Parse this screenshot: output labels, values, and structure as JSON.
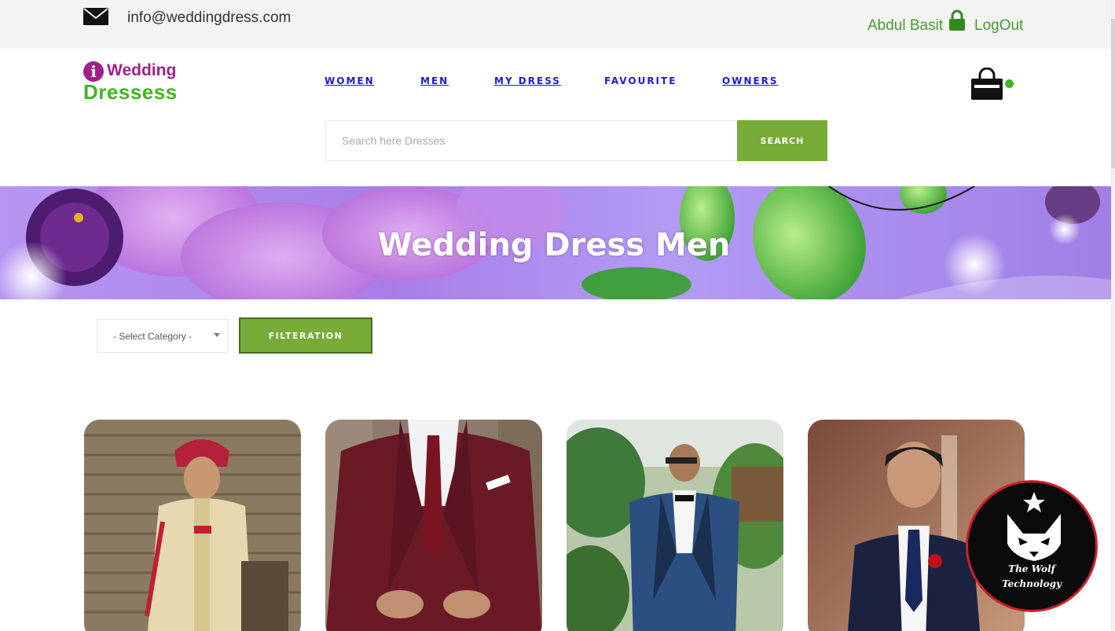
{
  "topbar": {
    "email": "info@weddingdress.com",
    "user_name": "Abdul Basit",
    "logout_label": "LogOut",
    "icons": [
      "mail-icon",
      "lock-icon"
    ]
  },
  "logo": {
    "letter": "i",
    "top_text": "Wedding",
    "bottom_text": "Dressess"
  },
  "nav": {
    "items": [
      {
        "label": "WOMEN"
      },
      {
        "label": "MEN"
      },
      {
        "label": "MY DRESS"
      },
      {
        "label": "FAVOURITE"
      },
      {
        "label": "OWNERS"
      }
    ]
  },
  "cart": {
    "icon": "shopping-bag-icon"
  },
  "search": {
    "placeholder": "Search here Dresses",
    "button_label": "SEARCH"
  },
  "banner": {
    "title": "Wedding Dress Men"
  },
  "filter": {
    "select_value": "- Select Category -",
    "button_label": "FILTERATION"
  },
  "products": [
    {
      "image": "groom-sherwani-photo"
    },
    {
      "image": "maroon-suit-photo"
    },
    {
      "image": "blue-tuxedo-photo"
    },
    {
      "image": "navy-suit-photo"
    }
  ],
  "watermark": {
    "line1": "The Wolf",
    "line2": "Technology",
    "icon": "wolf-icon"
  },
  "colors": {
    "accent_green": "#77ac38",
    "nav_blue": "#1a1adf",
    "logo_purple": "#a0208a",
    "logo_green": "#3cb81c",
    "user_green": "#4a9a2a"
  }
}
